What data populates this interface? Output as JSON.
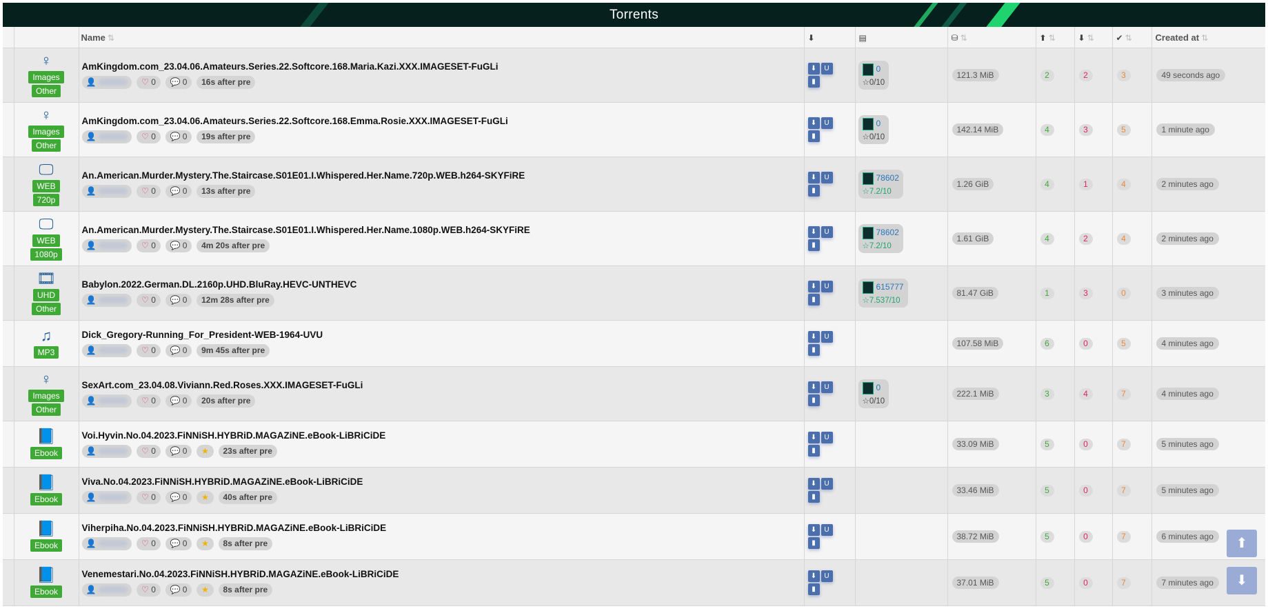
{
  "header": {
    "title": "Torrents"
  },
  "columns": {
    "name": "Name",
    "created": "Created at"
  },
  "rows": [
    {
      "cat_icon": "♀",
      "cat_badge": "Images",
      "res_badge": "Other",
      "name": "AmKingdom.com_23.04.06.Amateurs.Series.22.Softcore.168.Maria.Kazi.XXX.IMAGESET-FuGLi",
      "likes": "0",
      "comments": "0",
      "featured": false,
      "pre": "16s after pre",
      "meta_id": "0",
      "meta_rating": "0/10",
      "meta_good": false,
      "size": "121.3 MiB",
      "seeders": "2",
      "leechers": "2",
      "completed": "3",
      "age": "49 seconds ago"
    },
    {
      "cat_icon": "♀",
      "cat_badge": "Images",
      "res_badge": "Other",
      "name": "AmKingdom.com_23.04.06.Amateurs.Series.22.Softcore.168.Emma.Rosie.XXX.IMAGESET-FuGLi",
      "likes": "0",
      "comments": "0",
      "featured": false,
      "pre": "19s after pre",
      "meta_id": "0",
      "meta_rating": "0/10",
      "meta_good": false,
      "size": "142.14 MiB",
      "seeders": "4",
      "leechers": "3",
      "completed": "5",
      "age": "1 minute ago"
    },
    {
      "cat_icon": "🖵",
      "cat_badge": "WEB",
      "res_badge": "720p",
      "name": "An.American.Murder.Mystery.The.Staircase.S01E01.I.Whispered.Her.Name.720p.WEB.h264-SKYFiRE",
      "likes": "0",
      "comments": "0",
      "featured": false,
      "pre": "13s after pre",
      "meta_id": "78602",
      "meta_rating": "7.2/10",
      "meta_good": true,
      "size": "1.26 GiB",
      "seeders": "4",
      "leechers": "1",
      "completed": "4",
      "age": "2 minutes ago"
    },
    {
      "cat_icon": "🖵",
      "cat_badge": "WEB",
      "res_badge": "1080p",
      "name": "An.American.Murder.Mystery.The.Staircase.S01E01.I.Whispered.Her.Name.1080p.WEB.h264-SKYFiRE",
      "likes": "0",
      "comments": "0",
      "featured": false,
      "pre": "4m 20s after pre",
      "meta_id": "78602",
      "meta_rating": "7.2/10",
      "meta_good": true,
      "size": "1.61 GiB",
      "seeders": "4",
      "leechers": "2",
      "completed": "4",
      "age": "2 minutes ago"
    },
    {
      "cat_icon": "🎞",
      "cat_badge": "UHD",
      "res_badge": "Other",
      "name": "Babylon.2022.German.DL.2160p.UHD.BluRay.HEVC-UNTHEVC",
      "likes": "0",
      "comments": "0",
      "featured": false,
      "pre": "12m 28s after pre",
      "meta_id": "615777",
      "meta_rating": "7.537/10",
      "meta_good": true,
      "size": "81.47 GiB",
      "seeders": "1",
      "leechers": "3",
      "completed": "0",
      "age": "3 minutes ago"
    },
    {
      "cat_icon": "♫",
      "cat_badge": "MP3",
      "res_badge": "",
      "name": "Dick_Gregory-Running_For_President-WEB-1964-UVU",
      "likes": "0",
      "comments": "0",
      "featured": false,
      "pre": "9m 45s after pre",
      "meta_id": "",
      "meta_rating": "",
      "meta_good": false,
      "size": "107.58 MiB",
      "seeders": "6",
      "leechers": "0",
      "completed": "5",
      "age": "4 minutes ago"
    },
    {
      "cat_icon": "♀",
      "cat_badge": "Images",
      "res_badge": "Other",
      "name": "SexArt.com_23.04.08.Viviann.Red.Roses.XXX.IMAGESET-FuGLi",
      "likes": "0",
      "comments": "0",
      "featured": false,
      "pre": "20s after pre",
      "meta_id": "0",
      "meta_rating": "0/10",
      "meta_good": false,
      "size": "222.1 MiB",
      "seeders": "3",
      "leechers": "4",
      "completed": "7",
      "age": "4 minutes ago"
    },
    {
      "cat_icon": "📘",
      "cat_badge": "Ebook",
      "res_badge": "",
      "name": "Voi.Hyvin.No.04.2023.FiNNiSH.HYBRiD.MAGAZiNE.eBook-LiBRiCiDE",
      "likes": "0",
      "comments": "0",
      "featured": true,
      "pre": "23s after pre",
      "meta_id": "",
      "meta_rating": "",
      "meta_good": false,
      "size": "33.09 MiB",
      "seeders": "5",
      "leechers": "0",
      "completed": "7",
      "age": "5 minutes ago"
    },
    {
      "cat_icon": "📘",
      "cat_badge": "Ebook",
      "res_badge": "",
      "name": "Viva.No.04.2023.FiNNiSH.HYBRiD.MAGAZiNE.eBook-LiBRiCiDE",
      "likes": "0",
      "comments": "0",
      "featured": true,
      "pre": "40s after pre",
      "meta_id": "",
      "meta_rating": "",
      "meta_good": false,
      "size": "33.46 MiB",
      "seeders": "5",
      "leechers": "0",
      "completed": "7",
      "age": "5 minutes ago"
    },
    {
      "cat_icon": "📘",
      "cat_badge": "Ebook",
      "res_badge": "",
      "name": "Viherpiha.No.04.2023.FiNNiSH.HYBRiD.MAGAZiNE.eBook-LiBRiCiDE",
      "likes": "0",
      "comments": "0",
      "featured": true,
      "pre": "8s after pre",
      "meta_id": "",
      "meta_rating": "",
      "meta_good": false,
      "size": "38.72 MiB",
      "seeders": "5",
      "leechers": "0",
      "completed": "7",
      "age": "6 minutes ago"
    },
    {
      "cat_icon": "📘",
      "cat_badge": "Ebook",
      "res_badge": "",
      "name": "Venemestari.No.04.2023.FiNNiSH.HYBRiD.MAGAZiNE.eBook-LiBRiCiDE",
      "likes": "0",
      "comments": "0",
      "featured": true,
      "pre": "8s after pre",
      "meta_id": "",
      "meta_rating": "",
      "meta_good": false,
      "size": "37.01 MiB",
      "seeders": "5",
      "leechers": "0",
      "completed": "7",
      "age": "7 minutes ago"
    }
  ],
  "colors": {
    "badge_green": "#3fa935",
    "header_bg": "#06201e",
    "accent_green": "#1fd36e",
    "button_blue": "#4b6fad"
  }
}
